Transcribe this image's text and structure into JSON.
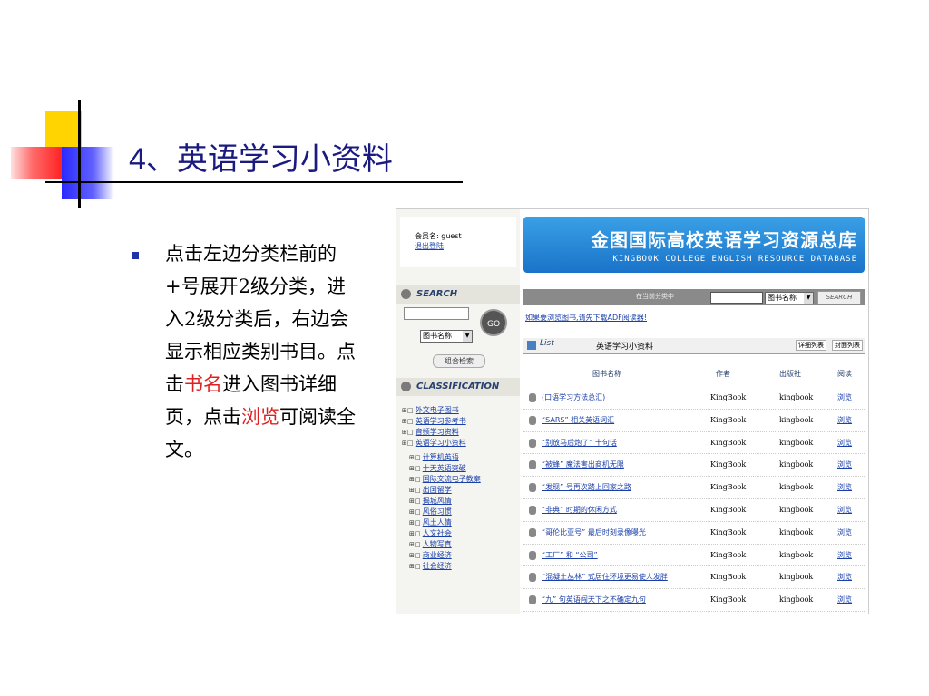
{
  "slide": {
    "title_num": "4",
    "title_text": "、英语学习小资料",
    "body": {
      "p1": "点击左边分类栏前的+号展开2级分类，进入2级分类后，右边会显示相应类别书目。点击",
      "red1": "书名",
      "p2": "进入图书详细页，点击",
      "red2": "浏览",
      "p3": "可阅读全文。"
    }
  },
  "shot": {
    "user": {
      "label": "会员名: guest",
      "logout": "退出登陆"
    },
    "banner": {
      "title": "金图国际高校英语学习资源总库",
      "subtitle": "KINGBOOK COLLEGE ENGLISH RESOURCE DATABASE"
    },
    "search": {
      "heading": "SEARCH",
      "go": "GO",
      "select": "图书名称",
      "combo": "组合检索"
    },
    "classification": {
      "heading": "CLASSIFICATION",
      "top": [
        "外文电子图书",
        "英语学习参考书",
        "音频学习资料",
        "英语学习小资料"
      ],
      "sub": [
        "计算机英语",
        "十天英语突破",
        "国际交流电子教案",
        "出国留学",
        "揭城风情",
        "风俗习惯",
        "风土人情",
        "人文社会",
        "人物写真",
        "商业经济",
        "社会经济"
      ]
    },
    "topbar": {
      "label": "在当前分类中",
      "select": "图书名称",
      "button": "SEARCH"
    },
    "notice": "如果要浏览图书,请先下载ADF阅读器!",
    "list": {
      "label": "List",
      "category": "英语学习小资料",
      "detail": "详细列表",
      "cover": "封面列表"
    },
    "table": {
      "headers": {
        "name": "图书名称",
        "author": "作者",
        "publisher": "出版社",
        "read": "阅读"
      },
      "rows": [
        {
          "title": "(口语学习方法总汇)",
          "author": "KingBook",
          "publisher": "kingbook",
          "read": "浏览"
        },
        {
          "title": "“SARS” 相关英语词汇",
          "author": "KingBook",
          "publisher": "kingbook",
          "read": "浏览"
        },
        {
          "title": "“别放马后炮了” 十句话",
          "author": "KingBook",
          "publisher": "kingbook",
          "read": "浏览"
        },
        {
          "title": "“被蜂” 魔法害出商机无限",
          "author": "KingBook",
          "publisher": "kingbook",
          "read": "浏览"
        },
        {
          "title": "“发现” 号再次踏上回家之路",
          "author": "KingBook",
          "publisher": "kingbook",
          "read": "浏览"
        },
        {
          "title": "“非典” 时期的休闲方式",
          "author": "KingBook",
          "publisher": "kingbook",
          "read": "浏览"
        },
        {
          "title": "“哥伦比亚号” 最后时刻录像曝光",
          "author": "KingBook",
          "publisher": "kingbook",
          "read": "浏览"
        },
        {
          "title": "“工厂” 和 “公司”",
          "author": "KingBook",
          "publisher": "kingbook",
          "read": "浏览"
        },
        {
          "title": "“混凝土丛林” 式居住环境更易使人发胖",
          "author": "KingBook",
          "publisher": "kingbook",
          "read": "浏览"
        },
        {
          "title": "“九” 句英语闯天下之不确定九句",
          "author": "KingBook",
          "publisher": "kingbook",
          "read": "浏览"
        }
      ]
    }
  }
}
